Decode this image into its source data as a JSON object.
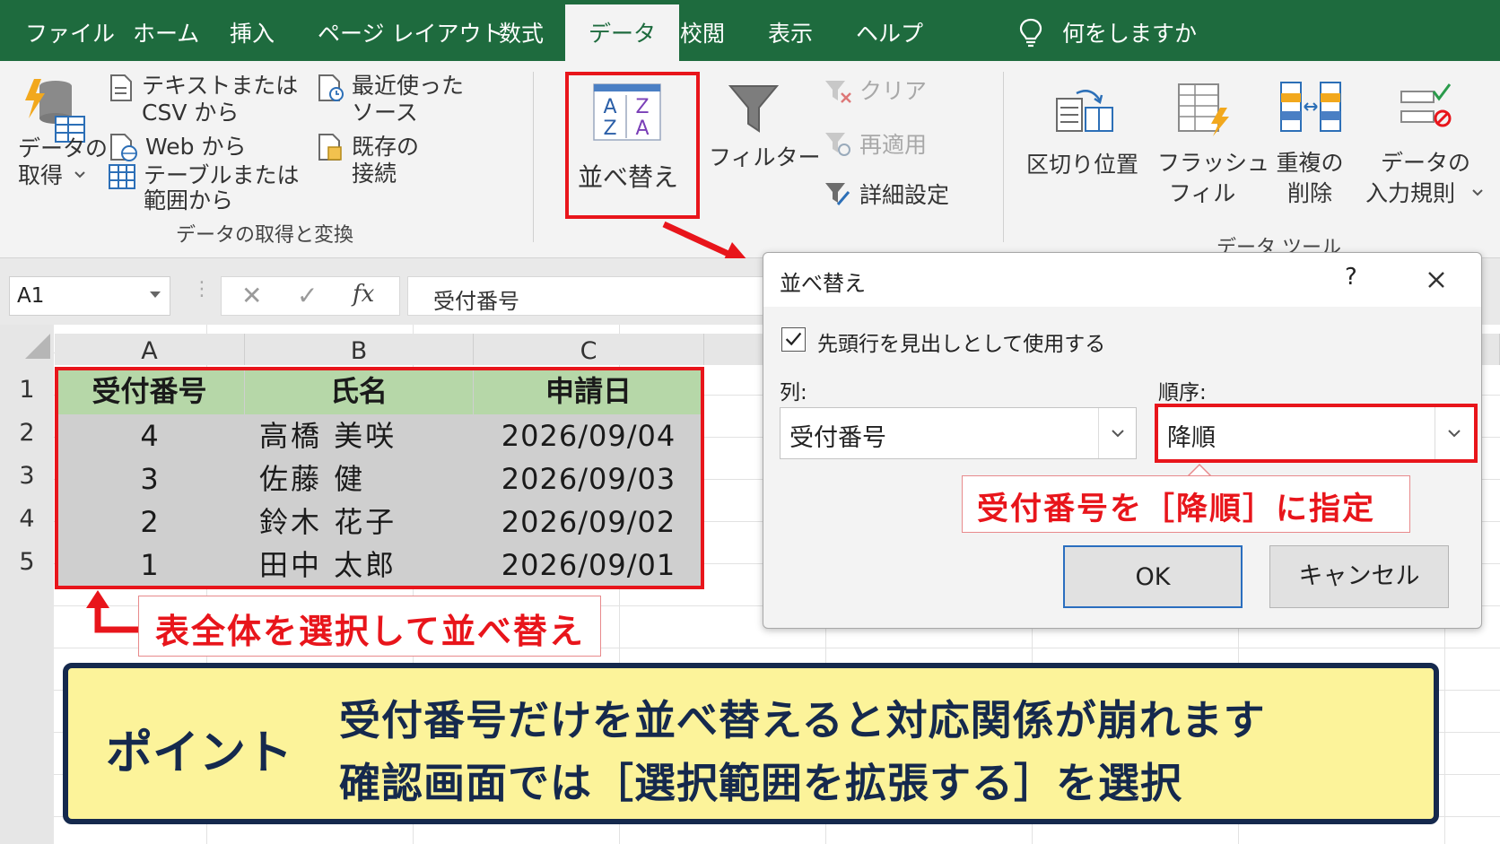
{
  "tabs": [
    "ファイル",
    "ホーム",
    "挿入",
    "ページ レイアウト",
    "数式",
    "データ",
    "校閲",
    "表示",
    "ヘルプ"
  ],
  "tell_me": "何をしますか",
  "ribbon": {
    "get_data_line1": "データの",
    "get_data_line2": "取得",
    "text_csv_line1": "テキストまたは",
    "text_csv_line2": "CSV から",
    "web": "Web から",
    "table_range_line1": "テーブルまたは",
    "table_range_line2": "範囲から",
    "recent_line1": "最近使った",
    "recent_line2": "ソース",
    "existing_line1": "既存の",
    "existing_line2": "接続",
    "group_get_transform": "データの取得と変換",
    "sort": "並べ替え",
    "filter": "フィルター",
    "clear": "クリア",
    "reapply": "再適用",
    "advanced": "詳細設定",
    "text_to_columns": "区切り位置",
    "flash_fill_line1": "フラッシュ",
    "flash_fill_line2": "フィル",
    "remove_dup_line1": "重複の",
    "remove_dup_line2": "削除",
    "validation_line1": "データの",
    "validation_line2": "入力規則",
    "group_data_tools": "データ ツール"
  },
  "formula_bar": {
    "name_box": "A1",
    "cancel": "✕",
    "enter": "✓",
    "fx": "fx",
    "content": "受付番号"
  },
  "sheet": {
    "columns": [
      "A",
      "B",
      "C"
    ],
    "rows": [
      "1",
      "2",
      "3",
      "4",
      "5"
    ],
    "header": [
      "受付番号",
      "氏名",
      "申請日"
    ],
    "data": [
      [
        "4",
        "高橋 美咲",
        "2026/09/04"
      ],
      [
        "3",
        "佐藤 健",
        "2026/09/03"
      ],
      [
        "2",
        "鈴木 花子",
        "2026/09/02"
      ],
      [
        "1",
        "田中 太郎",
        "2026/09/01"
      ]
    ]
  },
  "dialog": {
    "title": "並べ替え",
    "help": "?",
    "header_checkbox": "先頭行を見出しとして使用する",
    "column_label": "列:",
    "column_value": "受付番号",
    "order_label": "順序:",
    "order_value": "降順",
    "ok": "OK",
    "cancel": "キャンセル"
  },
  "annotations": {
    "order_callout": "受付番号を［降順］に指定",
    "select_callout": "表全体を選択して並べ替え",
    "point_label": "ポイント",
    "point_line1": "受付番号だけを並べ替えると対応関係が崩れます",
    "point_line2": "確認画面では［選択範囲を拡張する］を選択"
  },
  "colors": {
    "excel_green": "#1e6b3e",
    "highlight_red": "#e8151b",
    "header_fill": "#b6d7a8",
    "point_bg": "#fcf39a",
    "point_border": "#15294d"
  }
}
